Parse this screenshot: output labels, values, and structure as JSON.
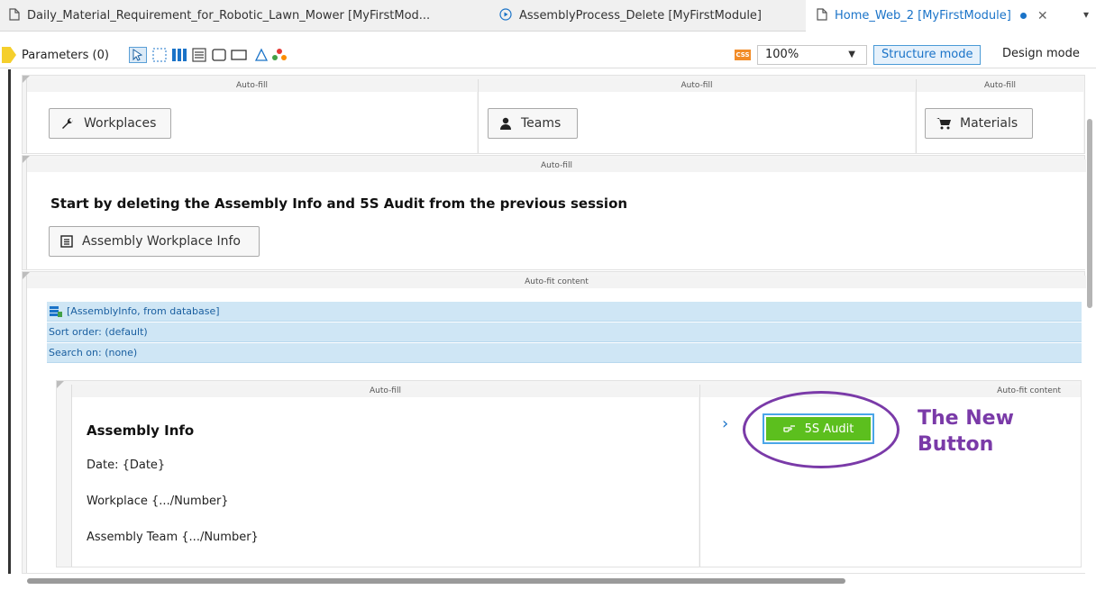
{
  "tabs": [
    {
      "label": "Daily_Material_Requirement_for_Robotic_Lawn_Mower [MyFirstMod...",
      "icon": "file-icon"
    },
    {
      "label": "AssemblyProcess_Delete [MyFirstModule]",
      "icon": "play-circle-icon"
    },
    {
      "label": "Home_Web_2 [MyFirstModule]",
      "icon": "file-icon",
      "active": true
    }
  ],
  "toolbar": {
    "parameters_label": "Parameters (0)",
    "css_label": "CSS",
    "zoom_value": "100%",
    "structure_mode_label": "Structure mode",
    "design_mode_label": "Design mode"
  },
  "top_row": {
    "cells": [
      {
        "label": "Auto-fill",
        "button": "Workplaces",
        "icon": "wrench-icon"
      },
      {
        "label": "Auto-fill",
        "button": "Teams",
        "icon": "user-icon"
      },
      {
        "label": "Auto-fill",
        "button": "Materials",
        "icon": "cart-icon"
      }
    ]
  },
  "second_row": {
    "label": "Auto-fill",
    "heading": "Start by deleting the Assembly Info and 5S Audit from the previous session",
    "button": "Assembly Workplace Info"
  },
  "dataview": {
    "label": "Auto-fit content",
    "source": "[AssemblyInfo, from database]",
    "sort_order": "Sort order: (default)",
    "search_on": "Search on: (none)",
    "inner_left_label": "Auto-fill",
    "inner_right_label": "Auto-fit content",
    "title": "Assembly Info",
    "date": "Date: {Date}",
    "workplace": "Workplace {.../Number}",
    "team": "Assembly Team {.../Number}",
    "button": "5S Audit"
  },
  "annotation": {
    "line1": "The New",
    "line2": "Button",
    "color": "#7a3aa8"
  }
}
